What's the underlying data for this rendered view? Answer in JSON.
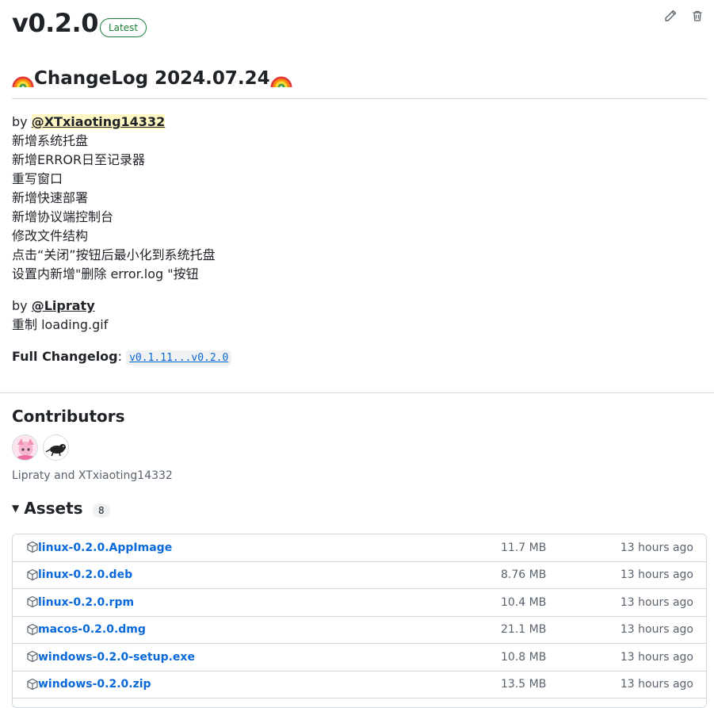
{
  "release": {
    "tag": "v0.2.0",
    "badge": "Latest",
    "edit_icon": "pencil-icon",
    "delete_icon": "trash-icon"
  },
  "changelog": {
    "heading": "ChangeLog 2024.07.24",
    "sections": [
      {
        "by": "by",
        "author": "@XTxiaoting14332",
        "items": [
          "新增系统托盘",
          "新增ERROR日至记录器",
          "重写窗口",
          "新增快速部署",
          "新增协议端控制台",
          "修改文件结构",
          "点击“关闭”按钮后最小化到系统托盘",
          "设置内新增\"删除 error.log \"按钮"
        ]
      },
      {
        "by": "by",
        "author": "@Lipraty",
        "items": [
          "重制 loading.gif"
        ]
      }
    ],
    "full_label": "Full Changelog",
    "full_sep": ":",
    "compare": "v0.1.11...v0.2.0"
  },
  "contributors": {
    "heading": "Contributors",
    "names": "Lipraty and XTxiaoting14332"
  },
  "assets": {
    "heading": "Assets",
    "count": "8",
    "files": [
      {
        "name": "linux-0.2.0.AppImage",
        "size": "11.7 MB",
        "time": "13 hours ago"
      },
      {
        "name": "linux-0.2.0.deb",
        "size": "8.76 MB",
        "time": "13 hours ago"
      },
      {
        "name": "linux-0.2.0.rpm",
        "size": "10.4 MB",
        "time": "13 hours ago"
      },
      {
        "name": "macos-0.2.0.dmg",
        "size": "21.1 MB",
        "time": "13 hours ago"
      },
      {
        "name": "windows-0.2.0-setup.exe",
        "size": "10.8 MB",
        "time": "13 hours ago"
      },
      {
        "name": "windows-0.2.0.zip",
        "size": "13.5 MB",
        "time": "13 hours ago"
      }
    ]
  },
  "colors": {
    "link": "#0969da",
    "latest": "#1a7f37",
    "mention_highlight": "#fff8c5"
  }
}
